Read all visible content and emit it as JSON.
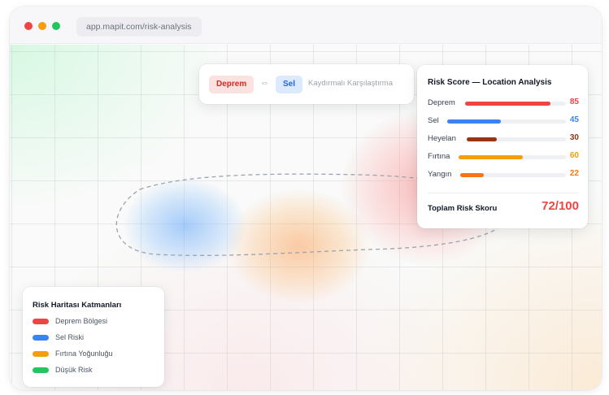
{
  "browser": {
    "url": "app.mapit.com/risk-analysis"
  },
  "compare": {
    "left_label": "Deprem",
    "swap_symbol": "⇔",
    "right_label": "Sel",
    "mode_label": "Kaydırmalı Karşılaştırma"
  },
  "risk_panel": {
    "title": "Risk Score — Location Analysis",
    "max_score": 100,
    "items": [
      {
        "label": "Deprem",
        "value": 85,
        "color": "#ef4444"
      },
      {
        "label": "Sel",
        "value": 45,
        "color": "#3b82f6"
      },
      {
        "label": "Heyelan",
        "value": 30,
        "color": "#9a3412"
      },
      {
        "label": "Fırtına",
        "value": 60,
        "color": "#f59e0b"
      },
      {
        "label": "Yangın",
        "value": 22,
        "color": "#f97316"
      }
    ],
    "total_label": "Toplam Risk Skoru",
    "total_value": "72/100"
  },
  "legend": {
    "title": "Risk Haritası Katmanları",
    "items": [
      {
        "label": "Deprem Bölgesi",
        "color": "#ef4444"
      },
      {
        "label": "Sel Riski",
        "color": "#3b82f6"
      },
      {
        "label": "Fırtına Yoğunluğu",
        "color": "#f59e0b"
      },
      {
        "label": "Düşük Risk",
        "color": "#22c55e"
      }
    ]
  }
}
